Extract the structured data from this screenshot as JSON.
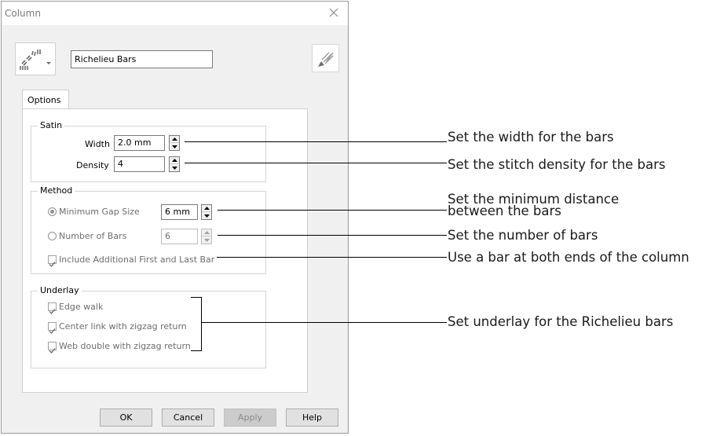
{
  "dialog": {
    "title": "Column",
    "name_value": "Richelieu Bars",
    "tab_label": "Options"
  },
  "satin": {
    "legend": "Satin",
    "width_label": "Width",
    "width_value": "2.0 mm",
    "density_label": "Density",
    "density_value": "4"
  },
  "method": {
    "legend": "Method",
    "min_gap_label": "Minimum Gap Size",
    "min_gap_value": "6 mm",
    "num_bars_label": "Number of Bars",
    "num_bars_value": "6",
    "include_label": "Include Additional First and Last Bar",
    "selected": "Minimum Gap Size",
    "include_checked": true
  },
  "underlay": {
    "legend": "Underlay",
    "edge_walk_label": "Edge walk",
    "center_link_label": "Center link with zigzag return",
    "web_double_label": "Web double with zigzag return",
    "checked": [
      true,
      true,
      true
    ]
  },
  "buttons": {
    "ok": "OK",
    "cancel": "Cancel",
    "apply": "Apply",
    "help": "Help"
  },
  "annotations": {
    "width": "Set the width for the bars",
    "density": "Set the stitch density for the bars",
    "gap_line1": "Set the minimum distance",
    "gap_line2": "between the bars",
    "number": "Set the number of bars",
    "include": "Use a bar at both ends of the column",
    "underlay": "Set underlay for the Richelieu bars"
  },
  "colors": {
    "dialog_bg": "#f0f0f0",
    "panel_bg": "#ffffff",
    "disabled_text": "#6d6d6d",
    "check_mark": "#707070"
  }
}
